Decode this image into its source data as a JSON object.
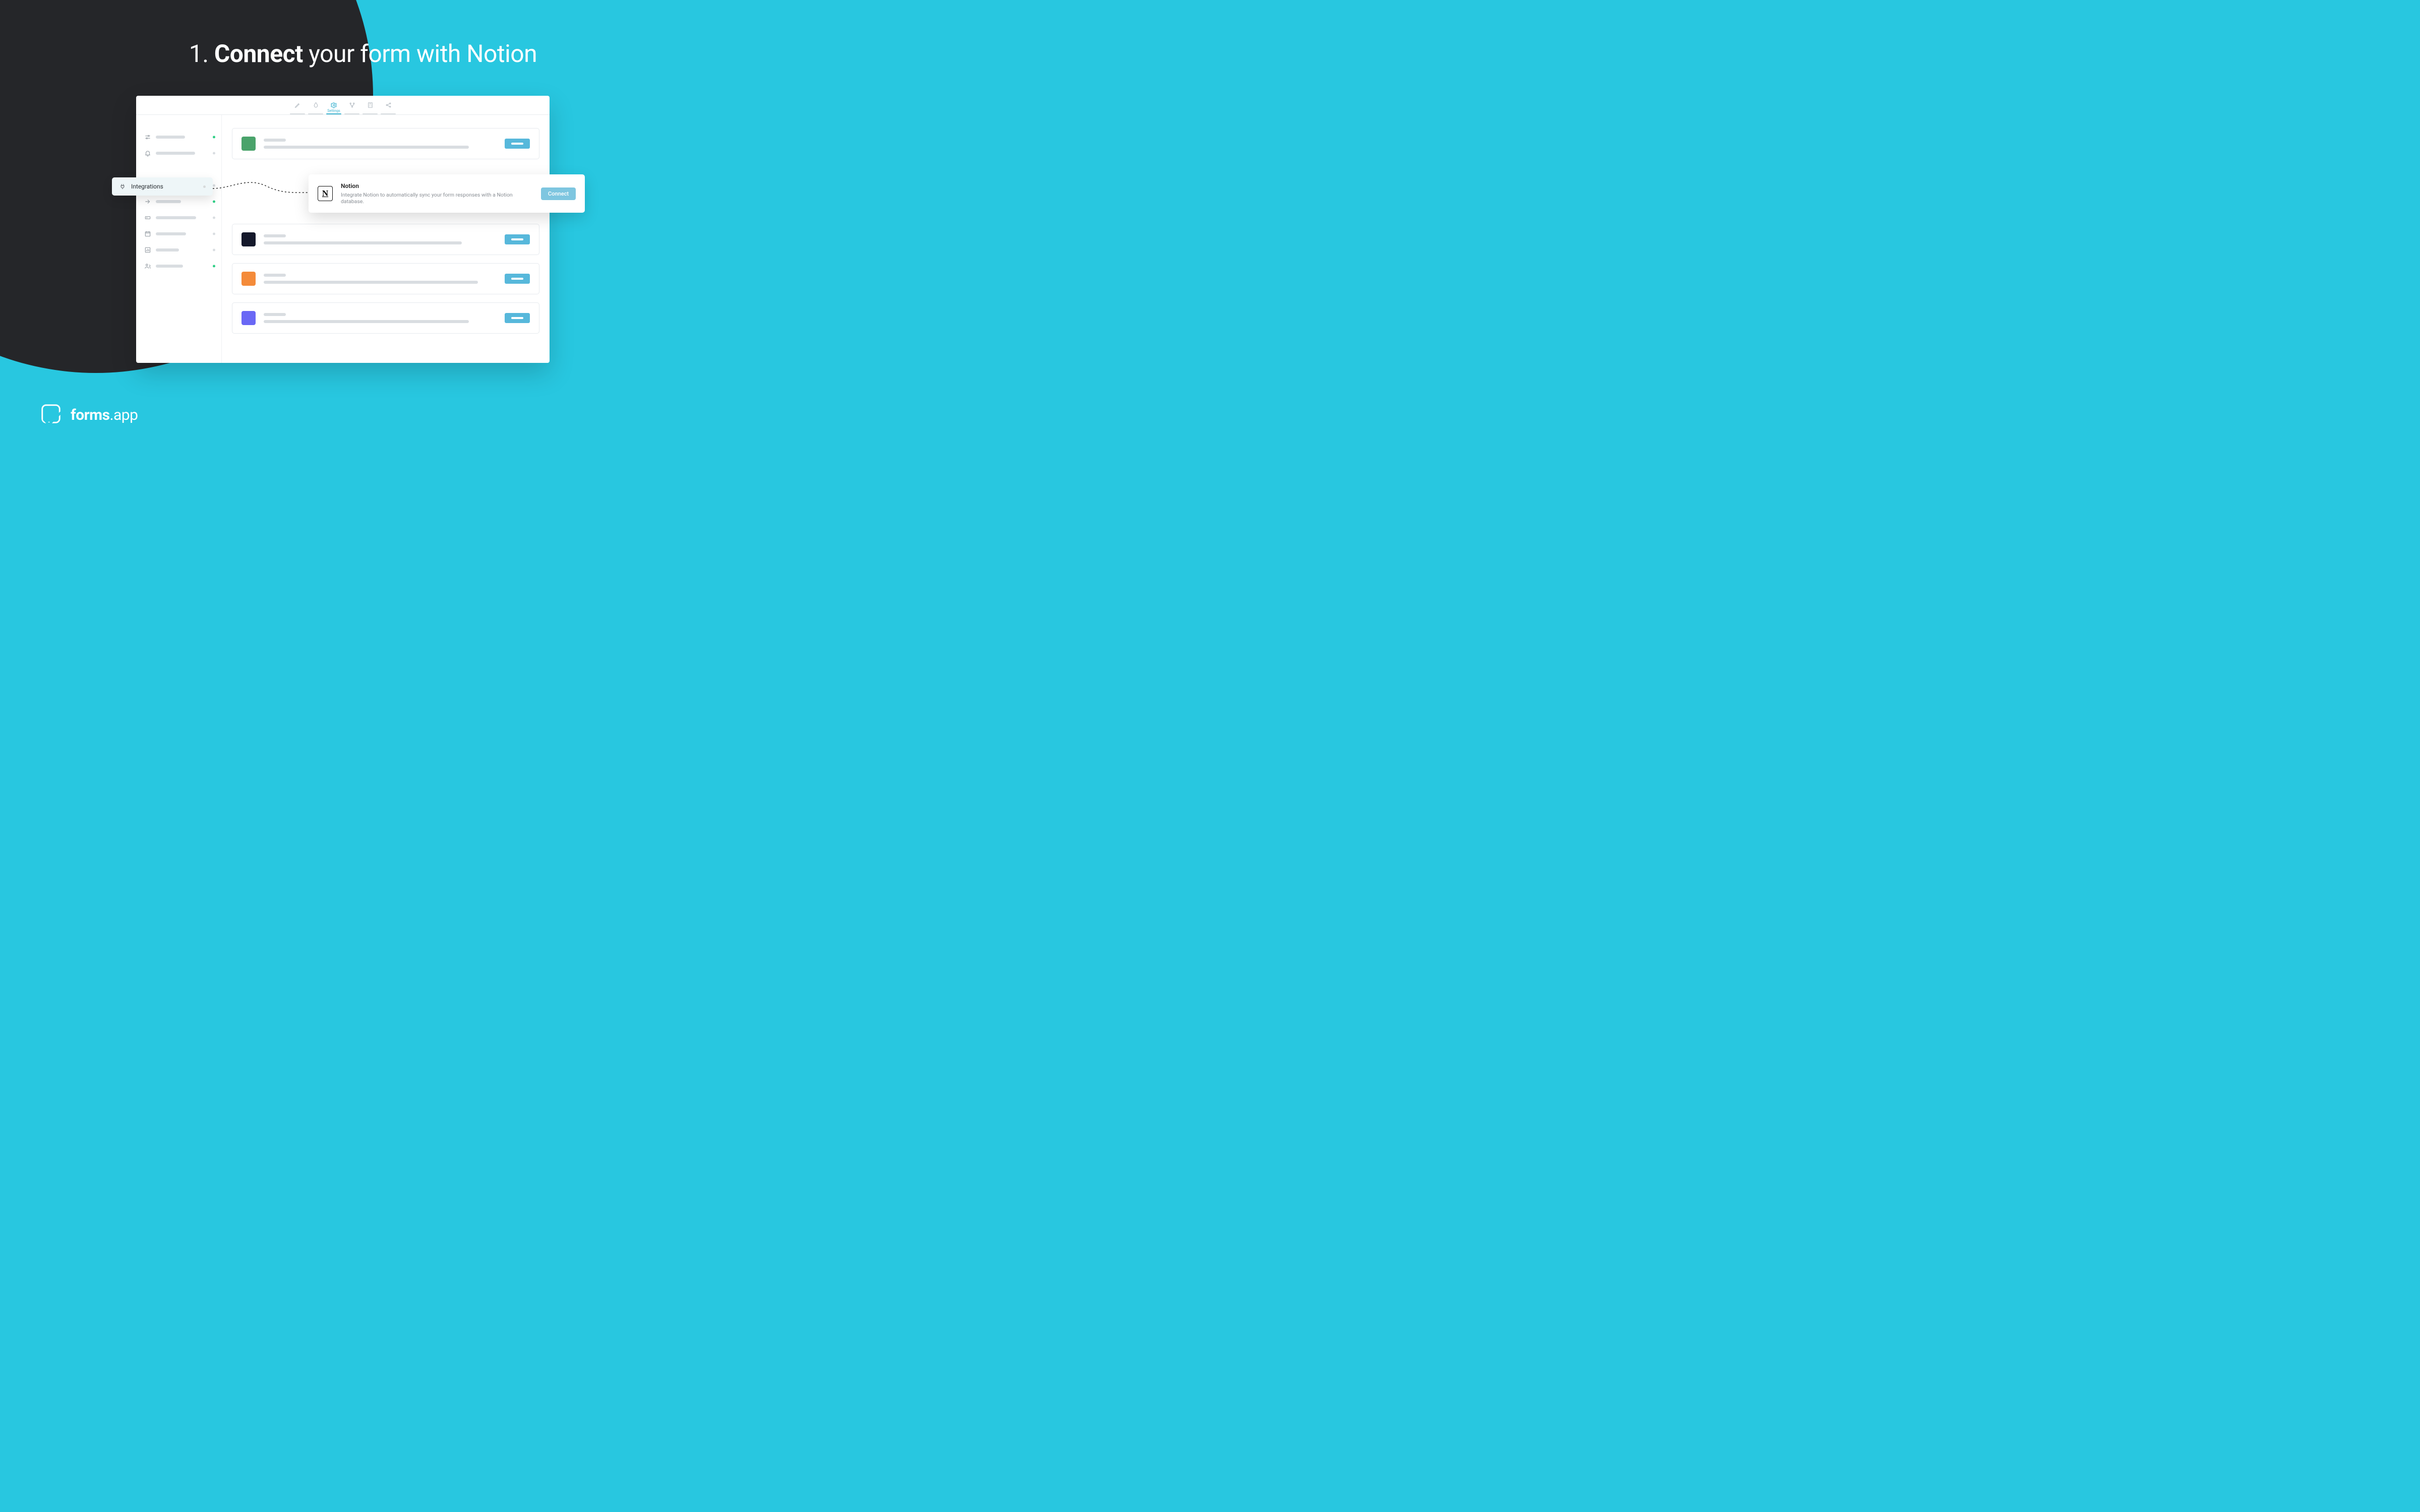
{
  "headline": {
    "number": "1.",
    "bold": "Connect",
    "rest": " your form with Notion"
  },
  "topbar": {
    "tabs": [
      {
        "name": "edit",
        "active": false
      },
      {
        "name": "design",
        "active": false
      },
      {
        "name": "settings",
        "active": true,
        "label": "Settings"
      },
      {
        "name": "logic",
        "active": false
      },
      {
        "name": "calc",
        "active": false
      },
      {
        "name": "share",
        "active": false
      }
    ]
  },
  "sidebar": {
    "active_label": "Integrations"
  },
  "notion": {
    "title": "Notion",
    "desc": "Integrate Notion to automatically sync your form responses with a Notion database.",
    "button": "Connect",
    "glyph": "N"
  },
  "brand": {
    "name1": "forms",
    "dot": ".",
    "name2": "app"
  }
}
